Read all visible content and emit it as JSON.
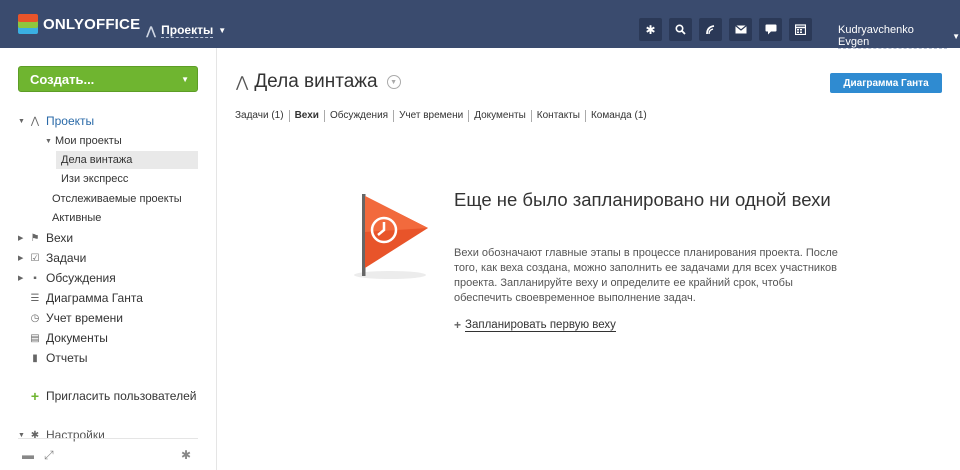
{
  "header": {
    "logo_text": "ONLYOFFICE",
    "module_label": "Проекты",
    "icons": [
      "gear-icon",
      "search-icon",
      "feed-icon",
      "mail-icon",
      "chat-icon",
      "calendar-icon"
    ],
    "user_name": "Kudryavchenko Evgen"
  },
  "sidebar": {
    "create_label": "Создать...",
    "projects_label": "Проекты",
    "my_projects_label": "Мои проекты",
    "projects": [
      "Дела винтажа",
      "Изи экспресс"
    ],
    "followed_label": "Отслеживаемые проекты",
    "active_label": "Активные",
    "items": [
      {
        "label": "Вехи",
        "icon": "flag-icon"
      },
      {
        "label": "Задачи",
        "icon": "task-icon"
      },
      {
        "label": "Обсуждения",
        "icon": "discussion-icon"
      },
      {
        "label": "Диаграмма Ганта",
        "icon": "gantt-icon"
      },
      {
        "label": "Учет времени",
        "icon": "clock-icon"
      },
      {
        "label": "Документы",
        "icon": "document-icon"
      },
      {
        "label": "Отчеты",
        "icon": "reports-icon"
      }
    ],
    "invite_label": "Пригласить пользователей",
    "settings_label": "Настройки"
  },
  "main": {
    "title": "Дела винтажа",
    "gantt_button": "Диаграмма Ганта",
    "tabs": [
      {
        "label": "Задачи (1)",
        "active": false
      },
      {
        "label": "Вехи",
        "active": true
      },
      {
        "label": "Обсуждения",
        "active": false
      },
      {
        "label": "Учет времени",
        "active": false
      },
      {
        "label": "Документы",
        "active": false
      },
      {
        "label": "Контакты",
        "active": false
      },
      {
        "label": "Команда (1)",
        "active": false
      }
    ],
    "empty_title": "Еще не было запланировано ни одной вехи",
    "empty_desc": "Вехи обозначают главные этапы в процессе планирования проекта. После того, как веха создана, можно заполнить ее задачами для всех участников проекта. Запланируйте веху и определите ее крайний срок, чтобы обеспечить своевременное выполнение задач.",
    "empty_link": "Запланировать первую веху"
  },
  "colors": {
    "header_bg": "#3a4b6e",
    "create_button": "#6fb530",
    "gantt_button": "#2f8bd1",
    "flag": "#e8542a"
  }
}
